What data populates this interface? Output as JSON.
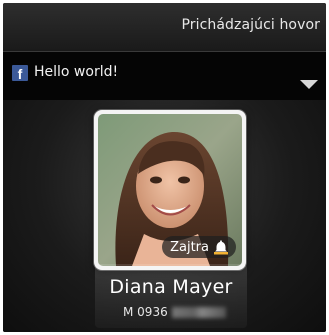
{
  "header": {
    "title": "Prichádzajúci hovor"
  },
  "notification": {
    "icon": "facebook-icon",
    "text": "Hello world!",
    "expand_icon": "chevron-down-icon"
  },
  "caller": {
    "photo": "contact-photo",
    "reminder_label": "Zajtra",
    "reminder_icon": "bell-icon",
    "name": "Diana Mayer",
    "number_prefix": "M 0936"
  },
  "colors": {
    "facebook": "#3b5998",
    "background": "#151515"
  }
}
